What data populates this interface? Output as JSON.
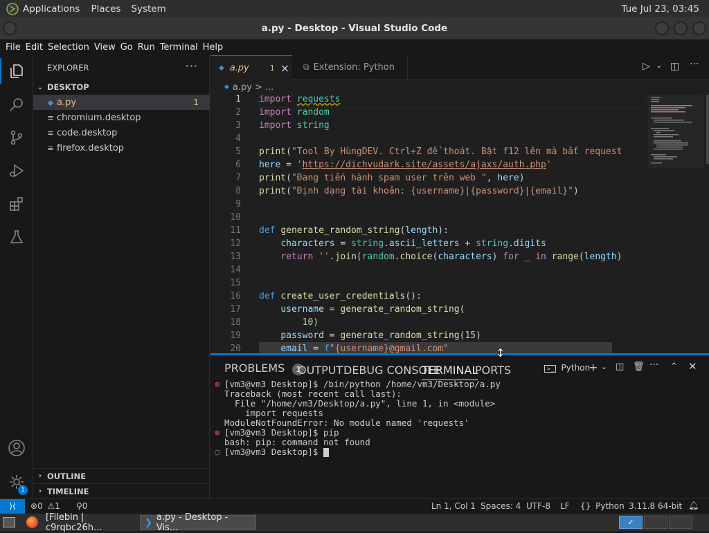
{
  "topbar": {
    "applications": "Applications",
    "places": "Places",
    "system": "System",
    "clock": "Tue Jul 23, 03:45"
  },
  "window": {
    "title": "a.py - Desktop - Visual Studio Code"
  },
  "menu": [
    "File",
    "Edit",
    "Selection",
    "View",
    "Go",
    "Run",
    "Terminal",
    "Help"
  ],
  "sidebar": {
    "title": "EXPLORER",
    "more": "···",
    "section": "DESKTOP",
    "files": [
      {
        "name": "a.py",
        "badge": "1"
      },
      {
        "name": "chromium.desktop"
      },
      {
        "name": "code.desktop"
      },
      {
        "name": "firefox.desktop"
      }
    ],
    "outline": "OUTLINE",
    "timeline": "TIMELINE"
  },
  "tabs": [
    {
      "label": "a.py",
      "badge": "1",
      "close": "×"
    },
    {
      "label": "Extension: Python"
    }
  ],
  "breadcrumb": {
    "file": "a.py",
    "sep": ">",
    "rest": "..."
  },
  "editor": {
    "lines": [
      {
        "n": "1",
        "t": "import requests"
      },
      {
        "n": "2",
        "t": "import random"
      },
      {
        "n": "3",
        "t": "import string"
      },
      {
        "n": "4",
        "t": ""
      },
      {
        "n": "5",
        "t": "print(\"Tool By HùngDEV. Ctrl+Z để thoát. Bật f12 lên mà bắt request"
      },
      {
        "n": "6",
        "t": "here = 'https://dichvudark.site/assets/ajaxs/auth.php'"
      },
      {
        "n": "7",
        "t": "print(\"Đang tiến hành spam user trên web \", here)"
      },
      {
        "n": "8",
        "t": "print(\"Định dạng tài khoản: {username}|{password}|{email}\")"
      },
      {
        "n": "9",
        "t": ""
      },
      {
        "n": "10",
        "t": ""
      },
      {
        "n": "11",
        "t": "def generate_random_string(length):"
      },
      {
        "n": "12",
        "t": "    characters = string.ascii_letters + string.digits"
      },
      {
        "n": "13",
        "t": "    return ''.join(random.choice(characters) for _ in range(length)"
      },
      {
        "n": "14",
        "t": ""
      },
      {
        "n": "15",
        "t": ""
      },
      {
        "n": "16",
        "t": "def create_user_credentials():"
      },
      {
        "n": "17",
        "t": "    username = generate_random_string("
      },
      {
        "n": "18",
        "t": "        10)"
      },
      {
        "n": "19",
        "t": "    password = generate_random_string(15)"
      },
      {
        "n": "20",
        "t": "    email = f\"{username}@gmail.com\""
      }
    ]
  },
  "panel": {
    "tabs": [
      "PROBLEMS",
      "OUTPUT",
      "DEBUG CONSOLE",
      "TERMINAL",
      "PORTS"
    ],
    "problems_count": "1",
    "shell": "Python",
    "terminal": [
      "[vm3@vm3 Desktop]$ /bin/python /home/vm3/Desktop/a.py",
      "Traceback (most recent call last):",
      "  File \"/home/vm3/Desktop/a.py\", line 1, in <module>",
      "    import requests",
      "ModuleNotFoundError: No module named 'requests'",
      "[vm3@vm3 Desktop]$ pip",
      "bash: pip: command not found",
      "[vm3@vm3 Desktop]$ "
    ]
  },
  "status": {
    "errors": "0",
    "warnings": "1",
    "ports": "0",
    "position": "Ln 1, Col 1",
    "spaces": "Spaces: 4",
    "encoding": "UTF-8",
    "eol": "LF",
    "language": "Python",
    "interpreter": "3.11.8 64-bit"
  },
  "taskbar": [
    {
      "label": "[Filebin | c9rqbc26h..."
    },
    {
      "label": "a.py - Desktop - Vis..."
    }
  ],
  "colors": {
    "accent": "#0078d4",
    "error": "#f14c4c"
  }
}
